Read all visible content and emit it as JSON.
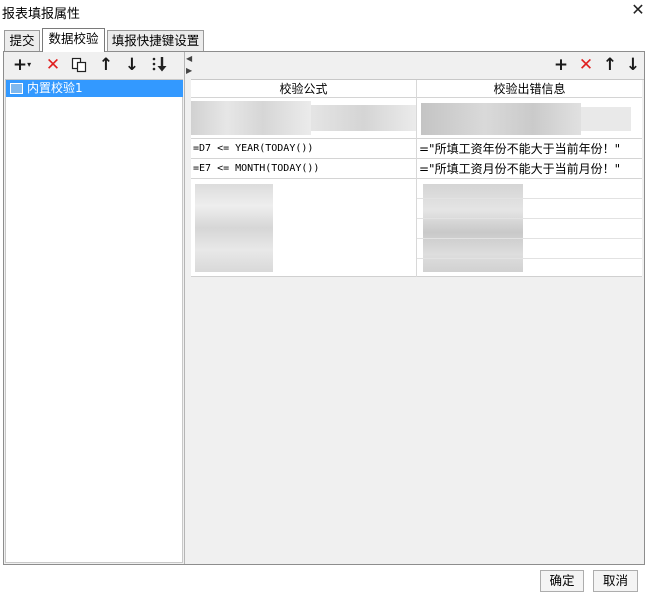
{
  "window": {
    "title": "报表填报属性"
  },
  "tabs": [
    {
      "label": "提交",
      "active": false
    },
    {
      "label": "数据校验",
      "active": true
    },
    {
      "label": "填报快捷键设置",
      "active": false
    }
  ],
  "left_toolbar": {
    "icons": [
      "add-dropdown-icon",
      "delete-icon",
      "copy-icon",
      "move-up-icon",
      "move-down-icon",
      "move-bottom-icon"
    ]
  },
  "left_list": {
    "items": [
      {
        "label": "内置校验1",
        "selected": true
      }
    ]
  },
  "right_toolbar": {
    "icons": [
      "add-icon",
      "delete-icon",
      "move-up-icon",
      "move-down-icon"
    ]
  },
  "table": {
    "columns": [
      "校验公式",
      "校验出错信息"
    ],
    "rows": [
      {
        "formula": "=D7 <= YEAR(TODAY())",
        "message": "=\"所填工资年份不能大于当前年份！\""
      },
      {
        "formula": "=E7 <= MONTH(TODAY())",
        "message": "=\"所填工资月份不能大于当前月份！\""
      }
    ]
  },
  "buttons": {
    "ok": "确定",
    "cancel": "取消"
  },
  "colors": {
    "selection": "#3399ff",
    "delete": "#e02020"
  }
}
